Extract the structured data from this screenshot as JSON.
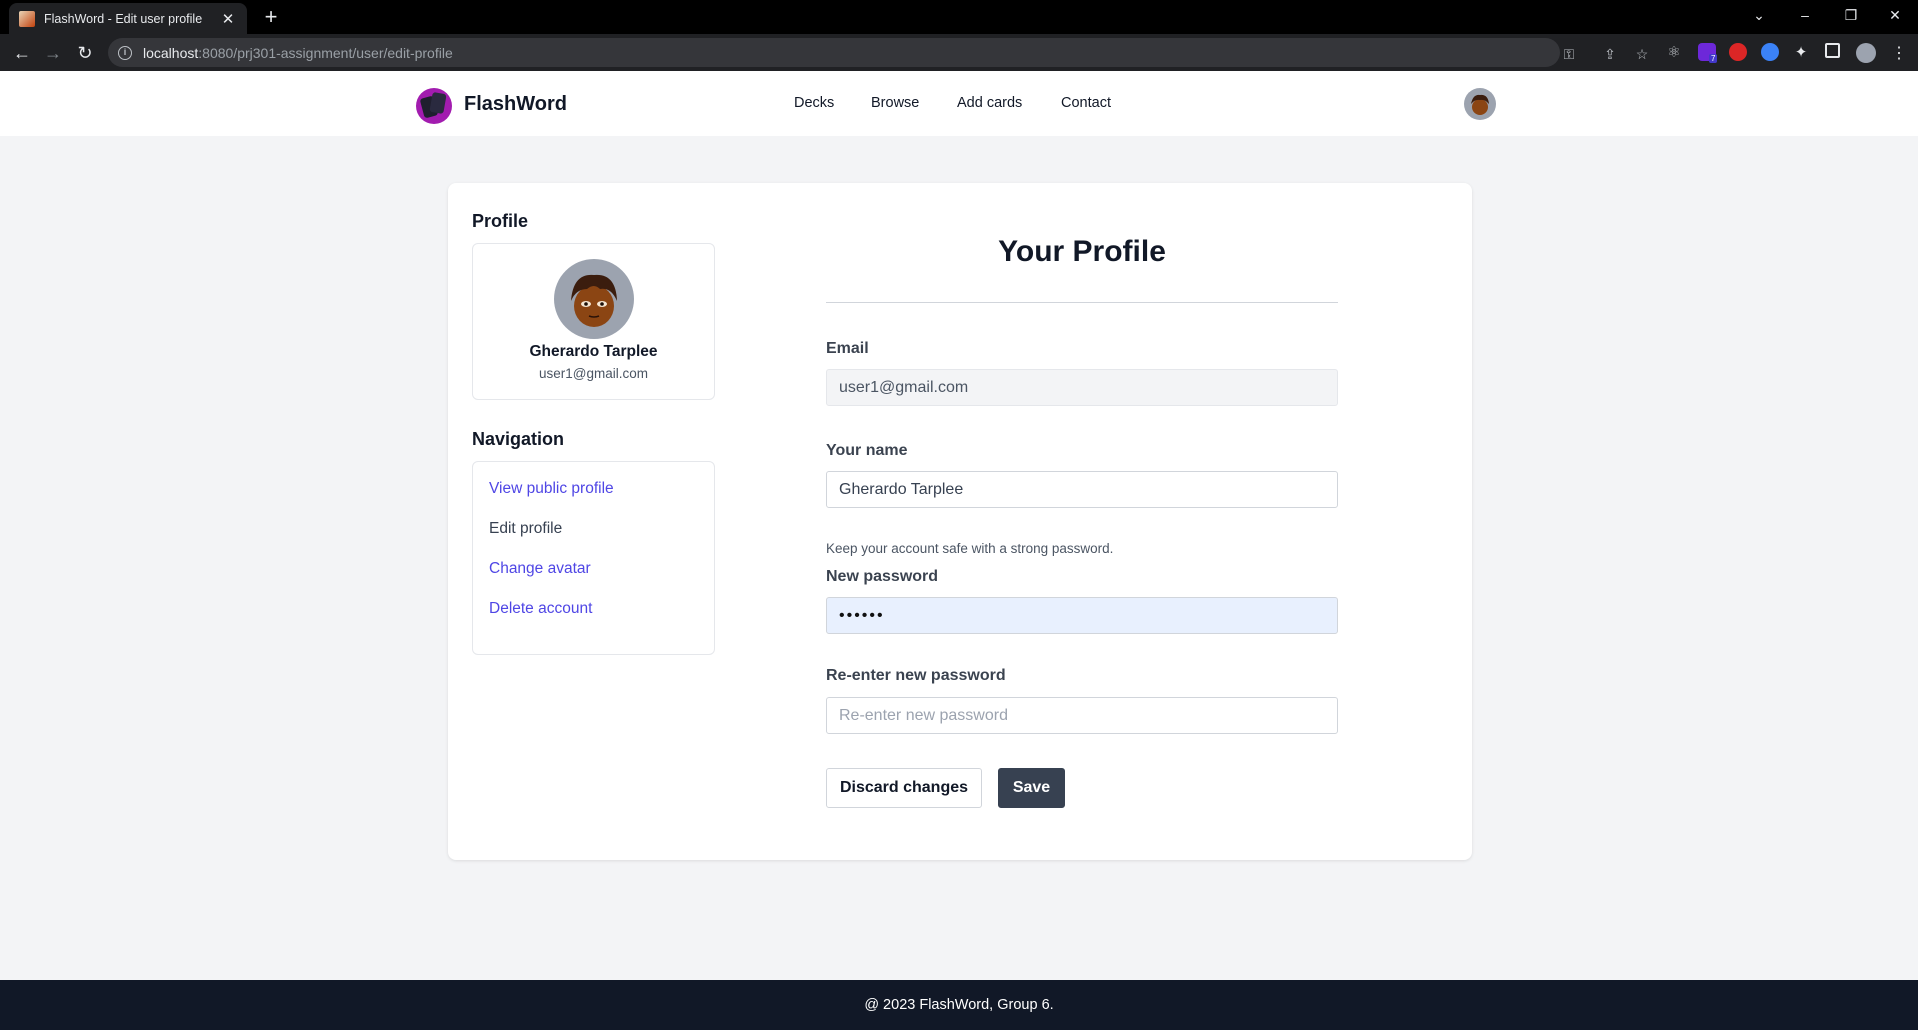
{
  "browser": {
    "tab_title": "FlashWord - Edit user profile",
    "url_host": "localhost",
    "url_path": ":8080/prj301-assignment/user/edit-profile",
    "extension_badge": "7"
  },
  "site": {
    "brand": "FlashWord",
    "nav": [
      "Decks",
      "Browse",
      "Add cards",
      "Contact"
    ]
  },
  "sidebar": {
    "profile_heading": "Profile",
    "user_name": "Gherardo Tarplee",
    "user_email": "user1@gmail.com",
    "navigation_heading": "Navigation",
    "nav_items": [
      "View public profile",
      "Edit profile",
      "Change avatar",
      "Delete account"
    ]
  },
  "form": {
    "title": "Your Profile",
    "email_label": "Email",
    "email_value": "user1@gmail.com",
    "name_label": "Your name",
    "name_value": "Gherardo Tarplee",
    "password_hint": "Keep your account safe with a strong password.",
    "new_password_label": "New password",
    "new_password_value": "••••••",
    "reenter_label": "Re-enter new password",
    "reenter_placeholder": "Re-enter new password",
    "discard_label": "Discard changes",
    "save_label": "Save"
  },
  "footer": {
    "text": "@ 2023 FlashWord, Group 6."
  },
  "colors": {
    "accent_link": "#4f46e5",
    "save_button": "#374151",
    "footer_bg": "#111827",
    "brand_logo": "#a21caf"
  }
}
